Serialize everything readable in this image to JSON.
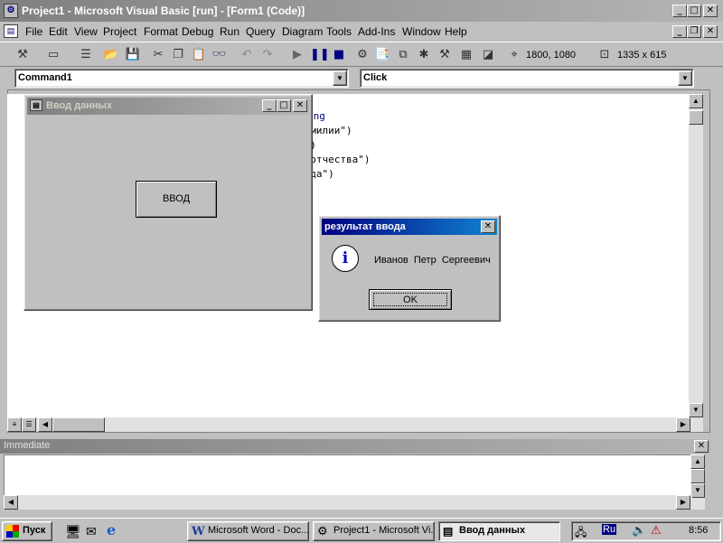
{
  "window": {
    "title": "Project1 - Microsoft Visual Basic [run] - [Form1 (Code)]"
  },
  "menu": [
    "File",
    "Edit",
    "View",
    "Project",
    "Format",
    "Debug",
    "Run",
    "Query",
    "Diagram",
    "Tools",
    "Add-Ins",
    "Window",
    "Help"
  ],
  "toolbar": {
    "position": "1800, 1080",
    "size": "1335 x 615"
  },
  "code_window": {
    "object_combo": "Command1",
    "procedure_combo": "Click",
    "lines": [
      "ing",
      "фамилии\")",
      "и\")",
      "д отчества\")",
      "вода\")"
    ]
  },
  "form": {
    "title": "Ввод данных",
    "button_label": "ВВОД"
  },
  "msgbox": {
    "title": "результат ввода",
    "message": "Иванов  Петр  Сергеевич",
    "ok_label": "OK"
  },
  "immediate": {
    "title": "Immediate"
  },
  "taskbar": {
    "start": "Пуск",
    "tasks": [
      "Microsoft Word - Doc...",
      "Project1 - Microsoft Vi...",
      "Ввод данных"
    ],
    "lang": "Ru",
    "clock": "8:56"
  }
}
